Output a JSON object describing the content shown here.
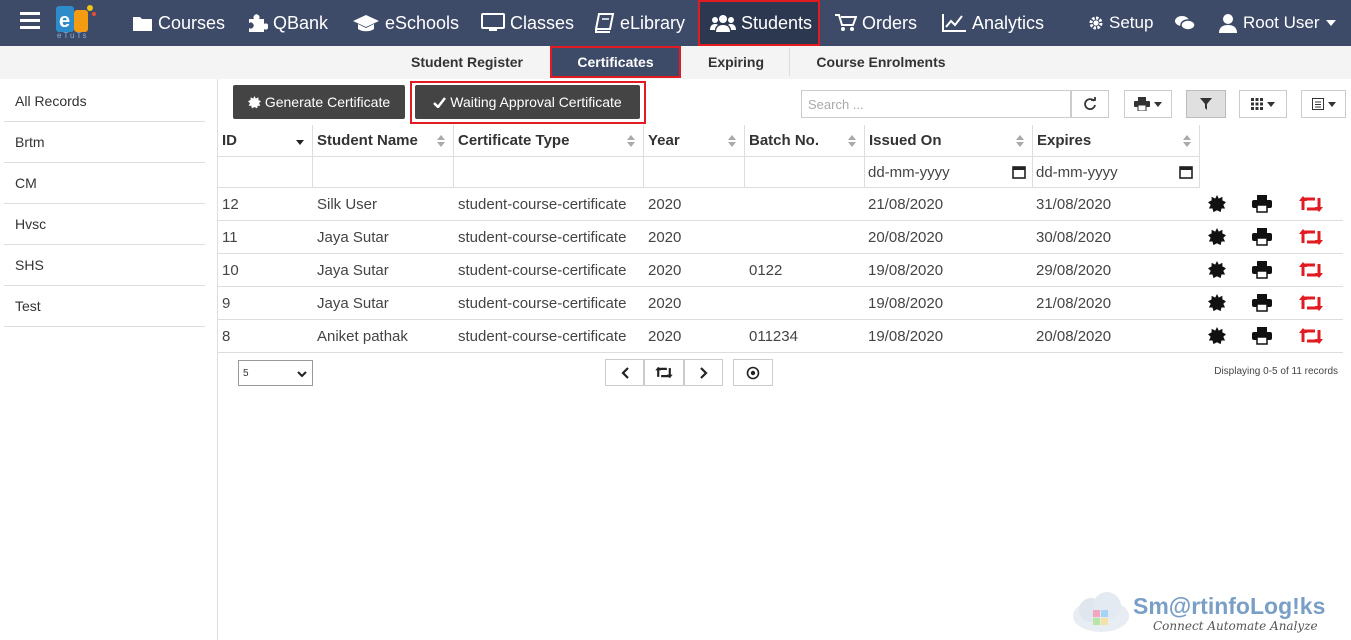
{
  "nav": {
    "items": [
      "Courses",
      "QBank",
      "eSchools",
      "Classes",
      "eLibrary",
      "Students",
      "Orders",
      "Analytics"
    ],
    "setup": "Setup",
    "user": "Root User",
    "active": "Students",
    "logo_caption": "eTuTs"
  },
  "subnav": {
    "items": [
      "Student Register",
      "Certificates",
      "Expiring",
      "Course Enrolments"
    ],
    "active": "Certificates"
  },
  "sidebar": {
    "items": [
      "All Records",
      "Brtm",
      "CM",
      "Hvsc",
      "SHS",
      "Test"
    ]
  },
  "toolbar": {
    "generate_label": "Generate Certificate",
    "waiting_label": "Waiting Approval Certificate",
    "search_placeholder": "Search ..."
  },
  "table": {
    "columns": [
      "ID",
      "Student Name",
      "Certificate Type",
      "Year",
      "Batch No.",
      "Issued On",
      "Expires"
    ],
    "date_placeholder": "dd-mm-yyyy",
    "rows": [
      {
        "id": "12",
        "name": "Silk User",
        "type": "student-course-certificate",
        "year": "2020",
        "batch": "",
        "issued": "21/08/2020",
        "expires": "31/08/2020"
      },
      {
        "id": "11",
        "name": "Jaya Sutar",
        "type": "student-course-certificate",
        "year": "2020",
        "batch": "",
        "issued": "20/08/2020",
        "expires": "30/08/2020"
      },
      {
        "id": "10",
        "name": "Jaya Sutar",
        "type": "student-course-certificate",
        "year": "2020",
        "batch": "0122",
        "issued": "19/08/2020",
        "expires": "29/08/2020"
      },
      {
        "id": "9",
        "name": "Jaya Sutar",
        "type": "student-course-certificate",
        "year": "2020",
        "batch": "",
        "issued": "19/08/2020",
        "expires": "21/08/2020"
      },
      {
        "id": "8",
        "name": "Aniket pathak",
        "type": "student-course-certificate",
        "year": "2020",
        "batch": "011234",
        "issued": "19/08/2020",
        "expires": "20/08/2020"
      }
    ]
  },
  "pagination": {
    "page_size": "5",
    "status": "Displaying 0-5 of 11 records"
  },
  "watermark": {
    "name": "Sm@rtinfoLog!ks",
    "tagline": "Connect Automate Analyze"
  },
  "colors": {
    "navbar": "#3d4a68",
    "highlight": "#e21b23",
    "button_dark": "#444444",
    "refresh_icon": "#e21b23"
  },
  "icons": {
    "nav": [
      "folder-icon",
      "puzzle-icon",
      "graduation-cap-icon",
      "monitor-icon",
      "book-icon",
      "users-icon",
      "cart-icon",
      "line-chart-icon"
    ],
    "row_actions": [
      "certificate-badge-icon",
      "print-icon",
      "retweet-icon"
    ]
  }
}
